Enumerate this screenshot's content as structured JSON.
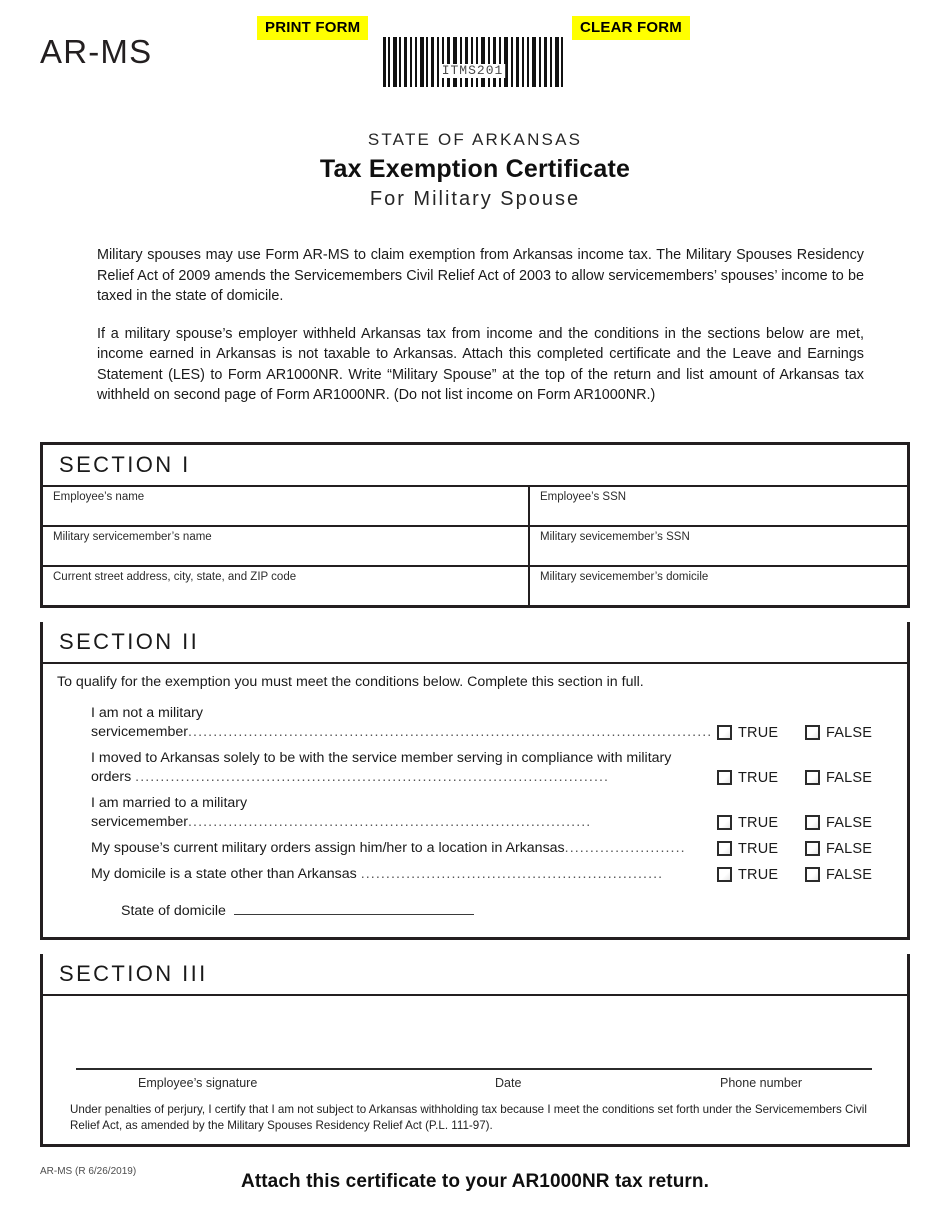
{
  "header": {
    "form_code": "AR-MS",
    "print_button": "PRINT FORM",
    "clear_button": "CLEAR FORM",
    "barcode_value": "ITMS201",
    "highlight_color": "#ffff00"
  },
  "title": {
    "state": "STATE OF ARKANSAS",
    "main": "Tax Exemption Certificate",
    "sub": "For Military Spouse"
  },
  "intro": {
    "paragraph_1": "Military spouses may use Form AR-MS to claim exemption from Arkansas income tax.  The Military Spouses Residency Relief Act of 2009 amends the Servicemembers Civil Relief Act of 2003 to allow servicemembers’ spouses’ income to be taxed in the state of domicile.",
    "paragraph_2": "If a military spouse’s employer withheld Arkansas tax from income and the conditions in the sections below are met, income earned in Arkansas is not taxable to Arkansas.  Attach this completed certificate and the Leave and Earnings Statement (LES) to Form AR1000NR.  Write “Military Spouse” at the top of the return and list amount of Arkansas tax withheld on second page of Form AR1000NR.  (Do not list income on Form AR1000NR.)"
  },
  "section_1": {
    "heading": "SECTION I",
    "fields": [
      {
        "left": "Employee’s name",
        "right": "Employee’s SSN"
      },
      {
        "left": "Military servicemember’s name",
        "right": "Military sevicemember’s SSN"
      },
      {
        "left": "Current street address, city, state, and ZIP code",
        "right": "Military sevicemember’s domicile"
      }
    ]
  },
  "section_2": {
    "heading": "SECTION II",
    "instruction": "To qualify for the exemption you must meet the conditions below.  Complete this section in full.",
    "true_label": "TRUE",
    "false_label": "FALSE",
    "statements": [
      {
        "text": "I am not a military servicemember",
        "leader": "........................................................................................................",
        "wrapped": false
      },
      {
        "text": "I moved to Arkansas solely to be with the service member serving in compliance with military orders ",
        "leader": "..............................................................................................",
        "wrapped": true
      },
      {
        "text": "I am married to a military servicemember",
        "leader": "................................................................................",
        "wrapped": false
      },
      {
        "text": "My spouse’s current military orders assign him/her to a location in Arkansas",
        "leader": "........................",
        "wrapped": false
      },
      {
        "text": "My domicile is a state other than Arkansas ",
        "leader": "............................................................",
        "wrapped": false
      }
    ],
    "domicile_label": "State of domicile"
  },
  "section_3": {
    "heading": "SECTION III",
    "signature_label": "Employee’s signature",
    "date_label": "Date",
    "phone_label": "Phone number",
    "perjury_statement": "Under penalties of perjury, I certify that I am not subject to Arkansas withholding tax because I meet the conditions set forth under the Servicemembers Civil Relief Act, as amended by the Military Spouses Residency Relief Act (P.L. 111-97)."
  },
  "footer": {
    "attach_note": "Attach this certificate to your AR1000NR tax return.",
    "revision": "AR-MS (R 6/26/2019)"
  }
}
